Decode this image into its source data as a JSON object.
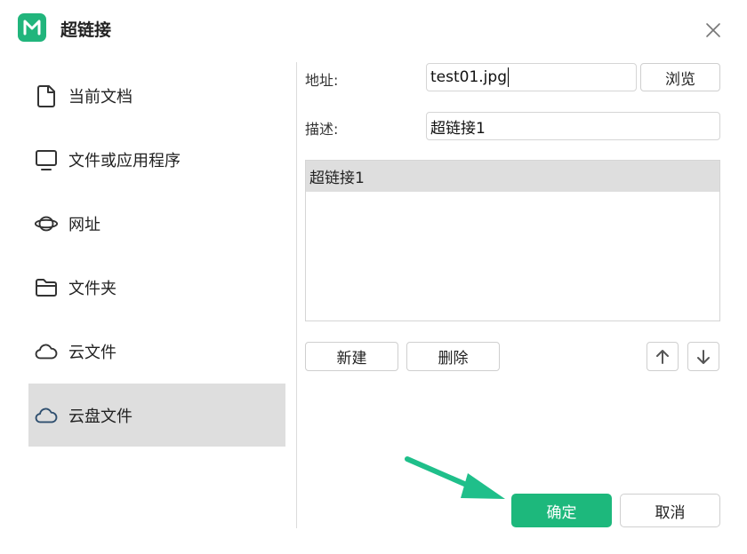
{
  "window": {
    "title": "超链接"
  },
  "sidebar": {
    "items": [
      {
        "label": "当前文档",
        "icon": "document-icon"
      },
      {
        "label": "文件或应用程序",
        "icon": "monitor-icon"
      },
      {
        "label": "网址",
        "icon": "planet-icon"
      },
      {
        "label": "文件夹",
        "icon": "folder-icon"
      },
      {
        "label": "云文件",
        "icon": "cloud-icon"
      },
      {
        "label": "云盘文件",
        "icon": "cloud-drive-icon",
        "selected": true
      }
    ]
  },
  "form": {
    "address_label": "地址:",
    "address_value": "test01.jpg",
    "browse_label": "浏览",
    "description_label": "描述:",
    "description_value": "超链接1"
  },
  "links_list": {
    "items": [
      "超链接1"
    ]
  },
  "actions": {
    "new_label": "新建",
    "delete_label": "删除",
    "ok_label": "确定",
    "cancel_label": "取消"
  },
  "colors": {
    "brand": "#1db87c",
    "selected_bg": "#dedede",
    "annotation_arrow": "#1fbf8a"
  }
}
